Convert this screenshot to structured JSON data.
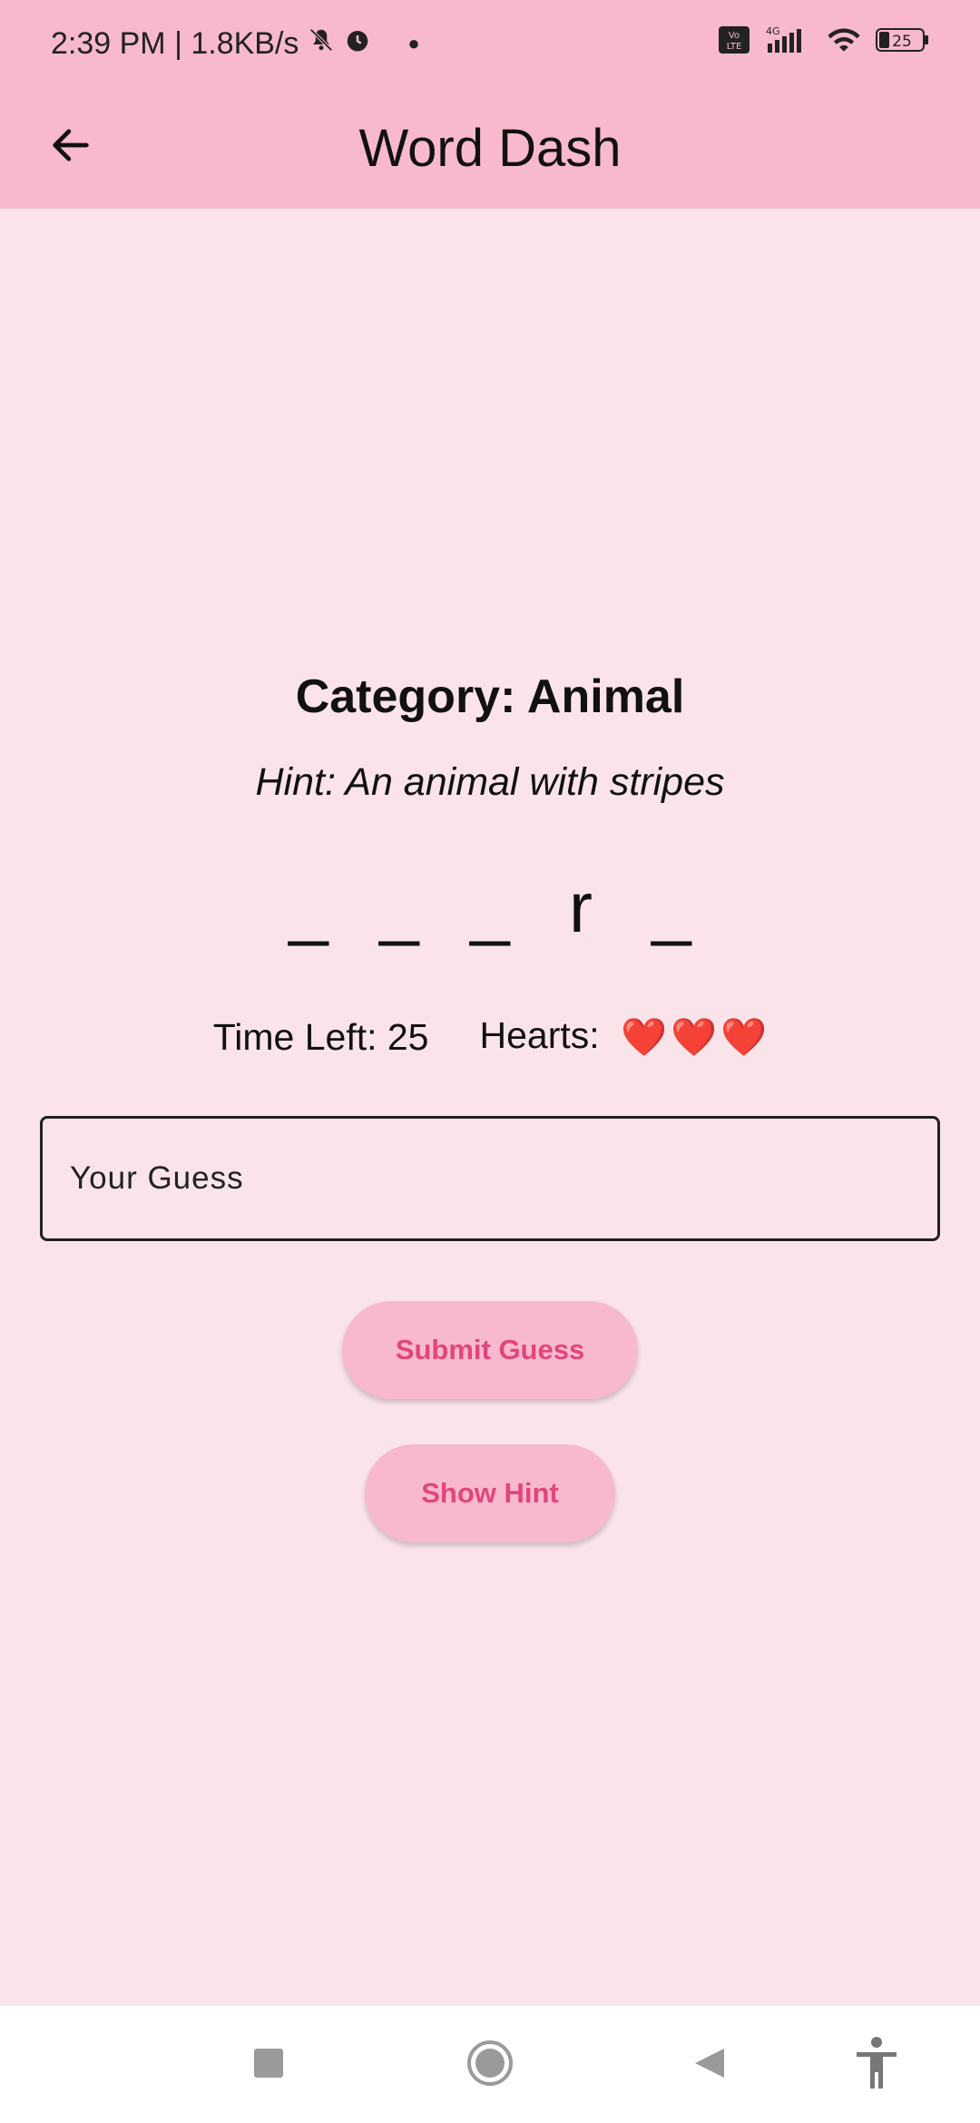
{
  "status_bar": {
    "time_speed": "2:39 PM | 1.8KB/s",
    "battery": "25",
    "network": "4G",
    "volte": "Vo LTE",
    "icons": [
      "mute-icon",
      "alarm-icon",
      "signal-icon",
      "wifi-icon",
      "battery-icon"
    ]
  },
  "app_bar": {
    "title": "Word Dash",
    "back_icon": "back-arrow-icon"
  },
  "game": {
    "category": "Category: Animal",
    "hint": "Hint: An animal with stripes",
    "letters": [
      "_",
      "_",
      "_",
      "r",
      "_"
    ],
    "time_left": "Time Left: 25",
    "hearts_label": "Hearts:",
    "hearts": [
      "❤️",
      "❤️",
      "❤️"
    ]
  },
  "guess_input": {
    "placeholder": "Your Guess",
    "value": ""
  },
  "buttons": {
    "submit": "Submit Guess",
    "show_hint": "Show Hint"
  },
  "nav_bar": {
    "items": [
      "recents-square-icon",
      "home-circle-icon",
      "back-triangle-icon",
      "accessibility-icon"
    ]
  },
  "colors": {
    "app_bar": "#f8b9cd",
    "background": "#fae4ea",
    "button_text": "#e2457b"
  }
}
